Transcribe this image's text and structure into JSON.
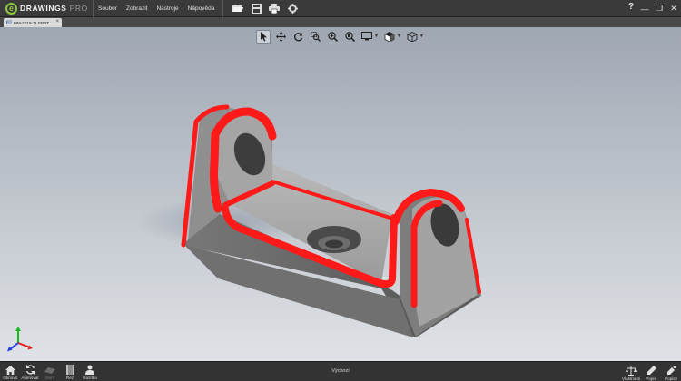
{
  "app": {
    "logo_letter": "e",
    "logo_text": "DRAWINGS",
    "logo_suffix": "PRO"
  },
  "menu": [
    "Soubor",
    "Zobrazit",
    "Nástroje",
    "Nápověda"
  ],
  "toolbar_icons": [
    "open-folder-icon",
    "save-icon",
    "print-icon",
    "gear-icon"
  ],
  "window": {
    "help": "?",
    "minimize": "—",
    "restore": "❐",
    "close": "✕"
  },
  "document_tab": {
    "label": "MM-2019-11.EPRT",
    "close": "×"
  },
  "view_tools": [
    "select-arrow-icon",
    "pan-icon",
    "rotate-icon",
    "zoom-to-area-icon",
    "zoom-in-icon",
    "zoom-to-fit-icon",
    "display-style-icon",
    "shaded-icon",
    "view-orientation-icon"
  ],
  "bottom_left": [
    {
      "label": "Obnovit",
      "icon": "home-icon",
      "enabled": true
    },
    {
      "label": "Animovat",
      "icon": "animate-icon",
      "enabled": true
    },
    {
      "label": "Měřit",
      "icon": "measure-icon",
      "enabled": false
    },
    {
      "label": "Řez",
      "icon": "section-icon",
      "enabled": true
    },
    {
      "label": "Razítka",
      "icon": "stamp-icon",
      "enabled": true
    }
  ],
  "bottom_center": "Výchozí",
  "bottom_right": [
    {
      "label": "Vlastnosti",
      "icon": "properties-icon"
    },
    {
      "label": "Popis",
      "icon": "markup-pen-icon"
    },
    {
      "label": "Popisy",
      "icon": "markups-icon"
    }
  ],
  "colors": {
    "highlight": "#ff1a1a",
    "part_gray": "#8c8c8c",
    "accent_green": "#8dc63f"
  }
}
